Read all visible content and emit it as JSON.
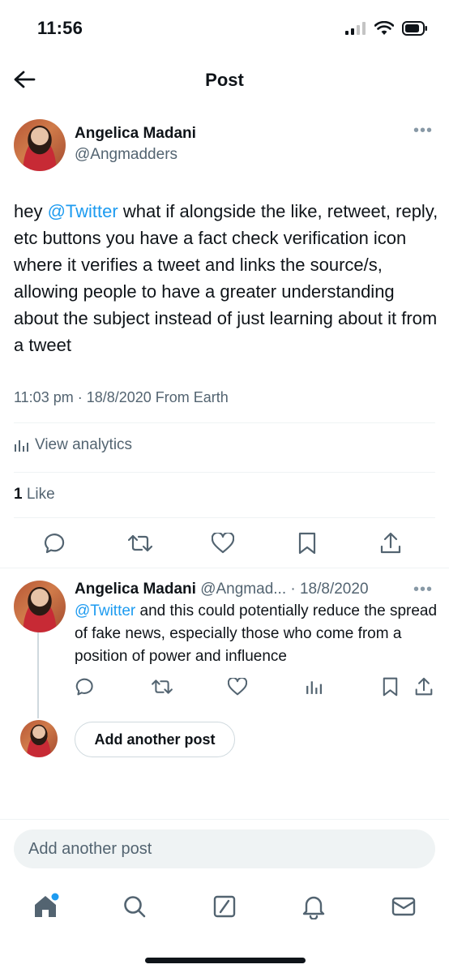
{
  "status_bar": {
    "time": "11:56"
  },
  "header": {
    "title": "Post"
  },
  "tweet": {
    "author_name": "Angelica Madani",
    "author_handle": "@Angmadders",
    "text_before": "hey ",
    "mention": "@Twitter",
    "text_after": " what if alongside the like, retweet, reply, etc buttons you have a fact check verification icon where it verifies a tweet and links the source/s, allowing people to have a greater understanding about the subject instead of just learning about it from a tweet",
    "timestamp": "11:03 pm · 18/8/2020 From Earth",
    "analytics_label": "View analytics",
    "like_count": "1",
    "like_label": " Like"
  },
  "reply": {
    "author_name": "Angelica Madani",
    "author_handle_date": "@Angmad... · 18/8/2020",
    "mention": "@Twitter",
    "text_after": " and this could potentially reduce the spread of fake news, especially those who come from a position of power and influence"
  },
  "add_another_button": "Add another post",
  "composer_placeholder": "Add another post",
  "colors": {
    "accent": "#1d9bf0",
    "text": "#0f1419",
    "secondary": "#536471"
  },
  "icons": [
    "back-arrow-icon",
    "more-icon",
    "reply-icon",
    "retweet-icon",
    "like-icon",
    "bookmark-icon",
    "share-icon",
    "analytics-icon",
    "home-icon",
    "search-icon",
    "grok-icon",
    "notifications-icon",
    "messages-icon"
  ]
}
